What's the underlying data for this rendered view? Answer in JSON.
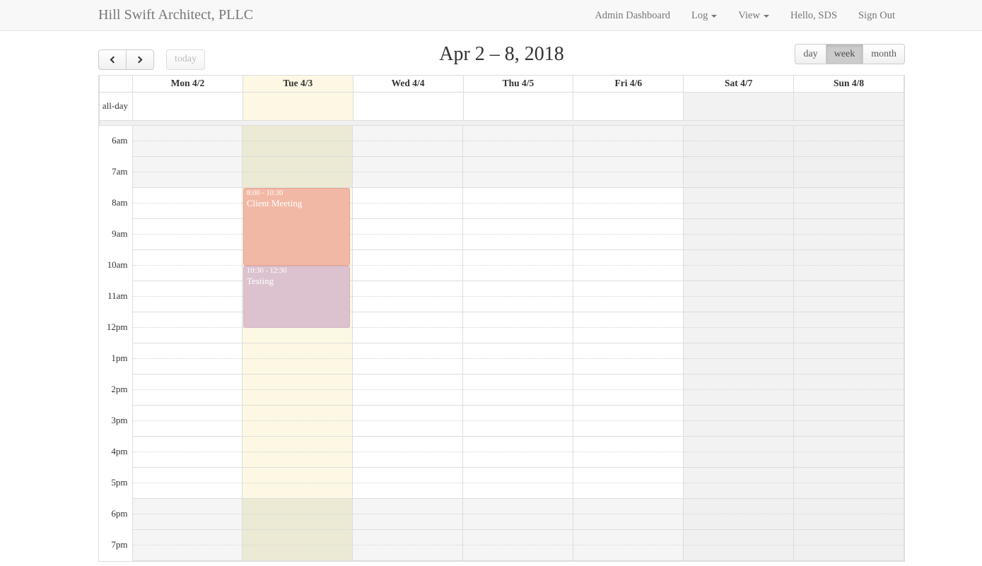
{
  "navbar": {
    "brand": "Hill Swift Architect, PLLC",
    "links": [
      {
        "label": "Admin Dashboard",
        "caret": false
      },
      {
        "label": "Log",
        "caret": true
      },
      {
        "label": "View",
        "caret": true
      },
      {
        "label": "Hello, SDS",
        "caret": false
      },
      {
        "label": "Sign Out",
        "caret": false
      }
    ]
  },
  "toolbar": {
    "prev_label": "prev-icon",
    "next_label": "next-icon",
    "today_label": "today",
    "title": "Apr 2 – 8, 2018",
    "views": [
      {
        "label": "day",
        "active": false
      },
      {
        "label": "week",
        "active": true
      },
      {
        "label": "month",
        "active": false
      }
    ]
  },
  "calendar": {
    "axis_header": "",
    "allday_label": "all-day",
    "days": [
      {
        "label": "Mon 4/2",
        "today": false,
        "weekend": false
      },
      {
        "label": "Tue 4/3",
        "today": true,
        "weekend": false
      },
      {
        "label": "Wed 4/4",
        "today": false,
        "weekend": false
      },
      {
        "label": "Thu 4/5",
        "today": false,
        "weekend": false
      },
      {
        "label": "Fri 4/6",
        "today": false,
        "weekend": false
      },
      {
        "label": "Sat 4/7",
        "today": false,
        "weekend": true
      },
      {
        "label": "Sun 4/8",
        "today": false,
        "weekend": true
      }
    ],
    "time_labels": [
      "6am",
      "7am",
      "8am",
      "9am",
      "10am",
      "11am",
      "12pm",
      "1pm",
      "2pm",
      "3pm",
      "4pm",
      "5pm",
      "6pm",
      "7pm"
    ],
    "business_hours": {
      "start": "8am",
      "end": "6pm"
    },
    "events": [
      {
        "time": "8:00 - 10:30",
        "title": "Client Meeting",
        "day": "Tue 4/3",
        "bg": "#f2b8a6",
        "border": "#e8a38d",
        "start_hour": 8.0,
        "end_hour": 10.5
      },
      {
        "time": "10:30 - 12:30",
        "title": "Testing",
        "day": "Tue 4/3",
        "bg": "#dcc2cf",
        "border": "#d0b3c2",
        "start_hour": 10.5,
        "end_hour": 12.5
      }
    ],
    "colors": {
      "today_highlight": "#fcf8e3",
      "weekend_shade": "#f2f2f2",
      "offhours_shade": "#f5f5f5",
      "grid_border": "#dddddd"
    }
  }
}
